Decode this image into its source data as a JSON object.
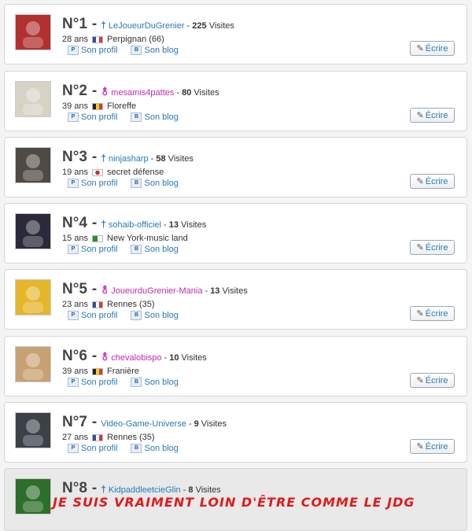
{
  "ranking": [
    {
      "rank": "N°1",
      "gender": "m",
      "username": "LeJoueurDuGrenier",
      "visits": "225",
      "visits_label": "Visites",
      "age": "28 ans",
      "flag": "fr",
      "location": "Perpignan (66)",
      "profile_label": "Son profil",
      "blog_label": "Son blog",
      "write_label": "Écrire",
      "avatar_color": "#b33030"
    },
    {
      "rank": "N°2",
      "gender": "f",
      "username": "mesamis4pattes",
      "visits": "80",
      "visits_label": "Visites",
      "age": "39 ans",
      "flag": "be",
      "location": "Floreffe",
      "profile_label": "Son profil",
      "blog_label": "Son blog",
      "write_label": "Écrire",
      "avatar_color": "#d8d2c4"
    },
    {
      "rank": "N°3",
      "gender": "m",
      "username": "ninjasharp",
      "visits": "58",
      "visits_label": "Visites",
      "age": "19 ans",
      "flag": "jp",
      "location": "secret défense",
      "profile_label": "Son profil",
      "blog_label": "Son blog",
      "write_label": "Écrire",
      "avatar_color": "#4f4a44"
    },
    {
      "rank": "N°4",
      "gender": "m",
      "username": "sohaib-officiel",
      "visits": "13",
      "visits_label": "Visites",
      "age": "15 ans",
      "flag": "dz",
      "location": "New York-music land",
      "profile_label": "Son profil",
      "blog_label": "Son blog",
      "write_label": "Écrire",
      "avatar_color": "#2a2a3a"
    },
    {
      "rank": "N°5",
      "gender": "f",
      "username": "JoueurduGrenier-Mania",
      "visits": "13",
      "visits_label": "Visites",
      "age": "23 ans",
      "flag": "fr",
      "location": "Rennes (35)",
      "profile_label": "Son profil",
      "blog_label": "Son blog",
      "write_label": "Écrire",
      "avatar_color": "#e5b52b"
    },
    {
      "rank": "N°6",
      "gender": "f",
      "username": "chevalobispo",
      "visits": "10",
      "visits_label": "Visites",
      "age": "39 ans",
      "flag": "be",
      "location": "Franière",
      "profile_label": "Son profil",
      "blog_label": "Son blog",
      "write_label": "Écrire",
      "avatar_color": "#c8a172"
    },
    {
      "rank": "N°7",
      "gender": "none",
      "username": "Video-Game-Universe",
      "visits": "9",
      "visits_label": "Visites",
      "age": "27 ans",
      "flag": "fr",
      "location": "Rennes (35)",
      "profile_label": "Son profil",
      "blog_label": "Son blog",
      "write_label": "Écrire",
      "avatar_color": "#3c4148"
    },
    {
      "rank": "N°8",
      "gender": "m",
      "username": "KidpaddleetcieGlin",
      "visits": "8",
      "visits_label": "Visites",
      "avatar_color": "#2c6e2a",
      "banner_text": "JE SUIS VRAIMENT LOIN D'ÊTRE COMME LE JDG"
    }
  ],
  "icons": {
    "profile": "profile-card-icon",
    "blog": "blog-icon",
    "write": "pencil-icon",
    "male": "male-icon",
    "female": "female-icon"
  }
}
